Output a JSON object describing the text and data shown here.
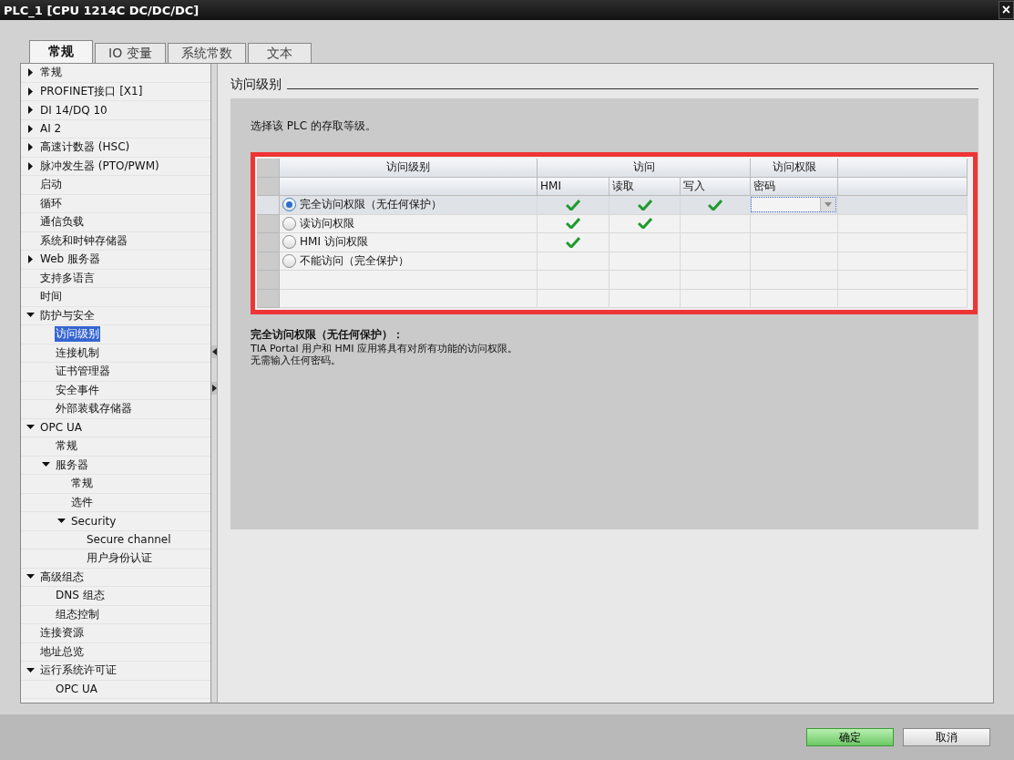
{
  "window": {
    "title": "PLC_1 [CPU 1214C DC/DC/DC]",
    "close": "×"
  },
  "tabs": [
    {
      "label": "常规",
      "selected": true
    },
    {
      "label": "IO 变量",
      "selected": false
    },
    {
      "label": "系统常数",
      "selected": false
    },
    {
      "label": "文本",
      "selected": false
    }
  ],
  "sidebar": {
    "items": [
      {
        "label": "常规",
        "expanded": false,
        "selected": false
      },
      {
        "label": "PROFINET接口 [X1]",
        "expanded": false,
        "selected": false
      },
      {
        "label": "DI 14/DQ 10",
        "expanded": false,
        "selected": false
      },
      {
        "label": "AI 2",
        "expanded": false,
        "selected": false
      },
      {
        "label": "高速计数器 (HSC)",
        "expanded": false,
        "selected": false
      },
      {
        "label": "脉冲发生器 (PTO/PWM)",
        "expanded": false,
        "selected": false
      },
      {
        "label": "启动",
        "selected": false
      },
      {
        "label": "循环",
        "selected": false
      },
      {
        "label": "通信负载",
        "selected": false
      },
      {
        "label": "系统和时钟存储器",
        "selected": false
      },
      {
        "label": "Web 服务器",
        "expanded": false,
        "selected": false
      },
      {
        "label": "支持多语言",
        "selected": false
      },
      {
        "label": "时间",
        "selected": false
      },
      {
        "label": "防护与安全",
        "expanded": true,
        "selected": false,
        "children": [
          {
            "label": "访问级别",
            "selected": true
          },
          {
            "label": "连接机制",
            "selected": false
          },
          {
            "label": "证书管理器",
            "selected": false
          },
          {
            "label": "安全事件",
            "selected": false
          },
          {
            "label": "外部装载存储器",
            "selected": false
          }
        ]
      },
      {
        "label": "OPC UA",
        "expanded": true,
        "selected": false,
        "children": [
          {
            "label": "常规",
            "selected": false
          },
          {
            "label": "服务器",
            "expanded": true,
            "selected": false,
            "children": [
              {
                "label": "常规",
                "selected": false
              },
              {
                "label": "选件",
                "selected": false
              },
              {
                "label": "Security",
                "expanded": true,
                "selected": false,
                "children": [
                  {
                    "label": "Secure channel",
                    "selected": false
                  },
                  {
                    "label": "用户身份认证",
                    "selected": false
                  }
                ]
              }
            ]
          }
        ]
      },
      {
        "label": "高级组态",
        "expanded": true,
        "selected": false,
        "children": [
          {
            "label": "DNS 组态",
            "selected": false
          },
          {
            "label": "组态控制",
            "selected": false
          }
        ]
      },
      {
        "label": "连接资源",
        "selected": false
      },
      {
        "label": "地址总览",
        "selected": false
      },
      {
        "label": "运行系统许可证",
        "expanded": true,
        "selected": false,
        "children": [
          {
            "label": "OPC UA",
            "selected": false
          }
        ]
      }
    ]
  },
  "section": {
    "title": "访问级别",
    "intro": "选择该 PLC 的存取等级。"
  },
  "table": {
    "group_headers": [
      "访问级别",
      "访问",
      "访问权限"
    ],
    "columns": [
      "HMI",
      "读取",
      "写入",
      "密码"
    ],
    "rows": [
      {
        "label": "完全访问权限（无任何保护）",
        "selected": true,
        "hmi": true,
        "read": true,
        "write": true
      },
      {
        "label": "读访问权限",
        "selected": false,
        "hmi": true,
        "read": true,
        "write": false
      },
      {
        "label": "HMI 访问权限",
        "selected": false,
        "hmi": true,
        "read": false,
        "write": false
      },
      {
        "label": "不能访问（完全保护）",
        "selected": false,
        "hmi": false,
        "read": false,
        "write": false
      }
    ]
  },
  "description": {
    "title": "完全访问权限（无任何保护）：",
    "lines": [
      "TIA Portal 用户和 HMI 应用将具有对所有功能的访问权限。",
      "无需输入任何密码。"
    ]
  },
  "buttons": [
    {
      "label": "确定",
      "kind": "primary"
    },
    {
      "label": "取消",
      "kind": "normal"
    }
  ]
}
